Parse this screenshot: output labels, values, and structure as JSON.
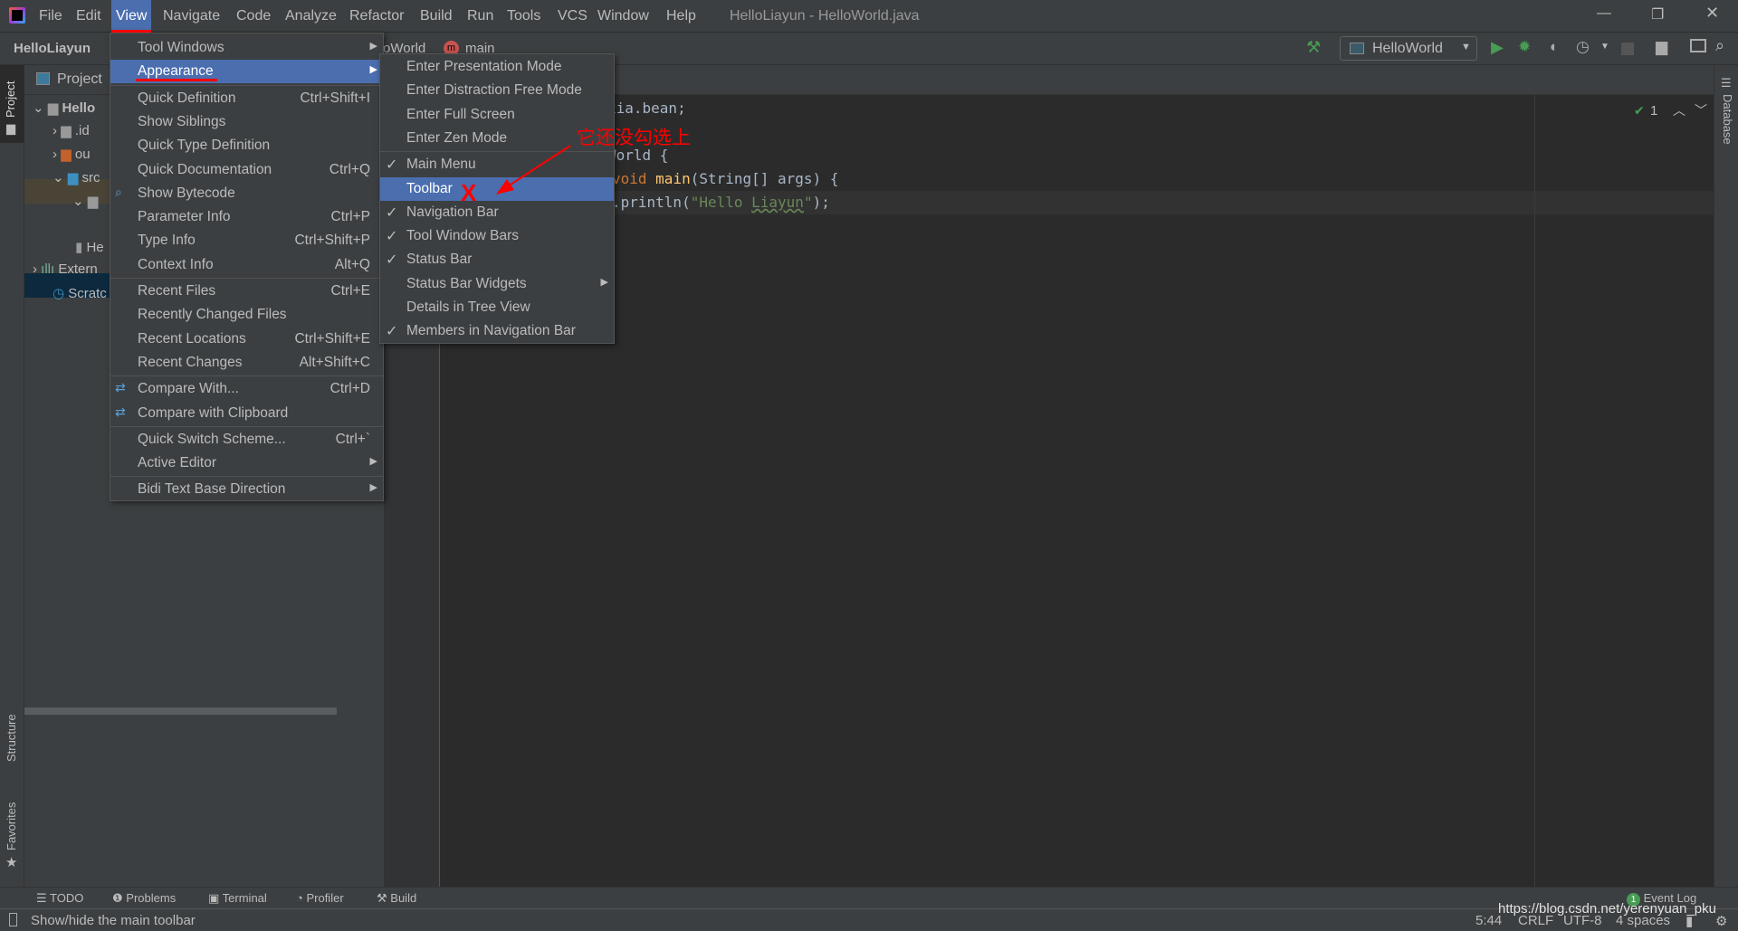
{
  "window": {
    "title": "HelloLiayun - HelloWorld.java"
  },
  "menubar": [
    "File",
    "Edit",
    "View",
    "Navigate",
    "Code",
    "Analyze",
    "Refactor",
    "Build",
    "Run",
    "Tools",
    "VCS",
    "Window",
    "Help"
  ],
  "navbar": {
    "project": "HelloLiayun",
    "class_fragment": "oWorld",
    "method": "main",
    "run_config": "HelloWorld"
  },
  "project_panel": {
    "title": "Project",
    "items": [
      "Hello",
      ".id",
      "ou",
      "src",
      "He",
      "Extern",
      "Scratc"
    ]
  },
  "side_tabs": {
    "project": "Project",
    "structure": "Structure",
    "favorites": "Favorites",
    "database": "Database"
  },
  "view_menu": {
    "items": [
      {
        "label": "Tool Windows",
        "shortcut": "",
        "submenu": true
      },
      {
        "label": "Appearance",
        "shortcut": "",
        "submenu": true,
        "selected": true
      },
      {
        "label": "Quick Definition",
        "shortcut": "Ctrl+Shift+I"
      },
      {
        "label": "Show Siblings",
        "shortcut": ""
      },
      {
        "label": "Quick Type Definition",
        "shortcut": ""
      },
      {
        "label": "Quick Documentation",
        "shortcut": "Ctrl+Q"
      },
      {
        "label": "Show Bytecode",
        "shortcut": ""
      },
      {
        "label": "Parameter Info",
        "shortcut": "Ctrl+P"
      },
      {
        "label": "Type Info",
        "shortcut": "Ctrl+Shift+P"
      },
      {
        "label": "Context Info",
        "shortcut": "Alt+Q"
      },
      {
        "label": "Recent Files",
        "shortcut": "Ctrl+E"
      },
      {
        "label": "Recently Changed Files",
        "shortcut": ""
      },
      {
        "label": "Recent Locations",
        "shortcut": "Ctrl+Shift+E"
      },
      {
        "label": "Recent Changes",
        "shortcut": "Alt+Shift+C"
      },
      {
        "label": "Compare With...",
        "shortcut": "Ctrl+D"
      },
      {
        "label": "Compare with Clipboard",
        "shortcut": ""
      },
      {
        "label": "Quick Switch Scheme...",
        "shortcut": "Ctrl+`"
      },
      {
        "label": "Active Editor",
        "shortcut": "",
        "submenu": true
      },
      {
        "label": "Bidi Text Base Direction",
        "shortcut": "",
        "submenu": true
      }
    ]
  },
  "appearance_menu": {
    "items": [
      {
        "label": "Enter Presentation Mode",
        "checked": false
      },
      {
        "label": "Enter Distraction Free Mode",
        "checked": false
      },
      {
        "label": "Enter Full Screen",
        "checked": false
      },
      {
        "label": "Enter Zen Mode",
        "checked": false
      },
      {
        "label": "Main Menu",
        "checked": true
      },
      {
        "label": "Toolbar",
        "checked": false,
        "selected": true
      },
      {
        "label": "Navigation Bar",
        "checked": true
      },
      {
        "label": "Tool Window Bars",
        "checked": true
      },
      {
        "label": "Status Bar",
        "checked": true
      },
      {
        "label": "Status Bar Widgets",
        "checked": false,
        "submenu": true
      },
      {
        "label": "Details in Tree View",
        "checked": false
      },
      {
        "label": "Members in Navigation Bar",
        "checked": true
      }
    ]
  },
  "editor": {
    "fragments": [
      "xia.bean;",
      "World {",
      "void main(String[] args) {",
      ".println(\"Hello Liayun\");"
    ],
    "inspections": "1"
  },
  "annotation": {
    "text": "它还没勾选上",
    "mark": "X",
    "color": "#ff0000"
  },
  "bottom_tools": [
    "TODO",
    "Problems",
    "Terminal",
    "Profiler",
    "Build"
  ],
  "event_log": {
    "label": "Event Log",
    "count": "1"
  },
  "status": {
    "message": "Show/hide the main toolbar",
    "position": "5:44",
    "line_sep": "CRLF",
    "encoding": "UTF-8",
    "indent": "4 spaces",
    "watermark": "https://blog.csdn.net/yerenyuan_pku"
  },
  "colors": {
    "accent": "#4b6eaf",
    "run_green": "#499c54",
    "panel": "#3c3f41",
    "editor": "#2b2b2b"
  }
}
